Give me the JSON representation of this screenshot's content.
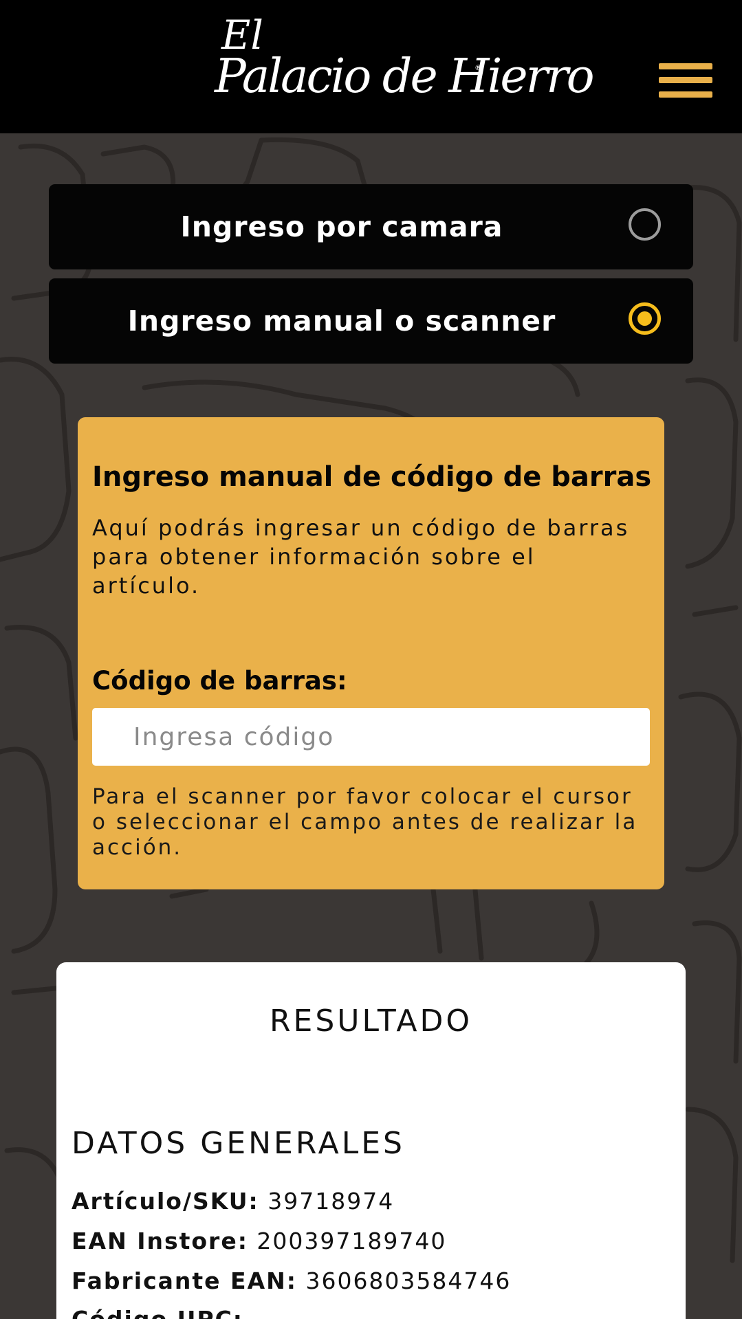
{
  "header": {
    "logo_line1": "El",
    "logo_line2": "Palacio de Hierro",
    "logo_reg": "®",
    "menu_icon": "hamburger-menu-icon",
    "accent_color": "#e9b04a"
  },
  "options": [
    {
      "label": "Ingreso por camara",
      "selected": false
    },
    {
      "label": "Ingreso manual o scanner",
      "selected": true
    }
  ],
  "manual": {
    "title": "Ingreso manual de código de barras",
    "description": "Aquí podrás ingresar un código de barras para obtener información sobre el artículo.",
    "barcode_label": "Código de barras:",
    "barcode_placeholder": "Ingresa código",
    "barcode_value": "",
    "scanner_note": "Para el scanner por favor colocar el cursor o seleccionar el campo antes de realizar la acción.",
    "card_color": "#eab14a"
  },
  "result": {
    "title": "RESULTADO",
    "general_title": "DATOS GENERALES",
    "fields": [
      {
        "label": "Artículo/SKU:",
        "value": "39718974"
      },
      {
        "label": "EAN Instore:",
        "value": "200397189740"
      },
      {
        "label": "Fabricante EAN:",
        "value": "3606803584746"
      },
      {
        "label": "Código UPC:",
        "value": ""
      }
    ]
  }
}
